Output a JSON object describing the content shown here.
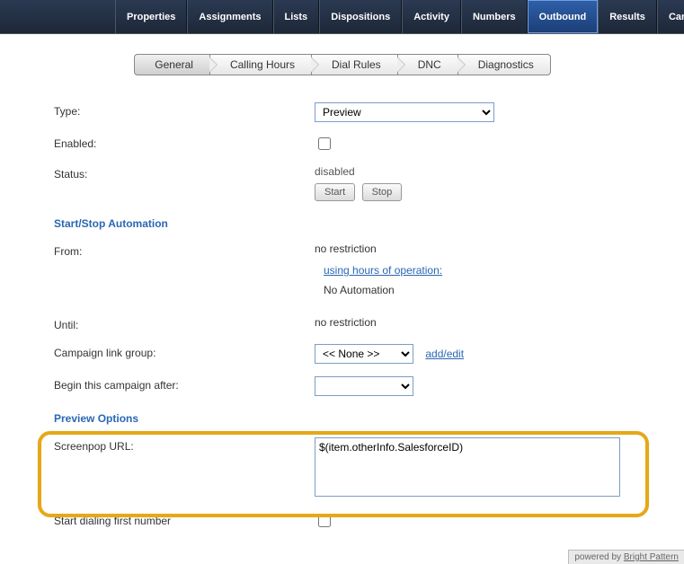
{
  "topnav": {
    "tabs": [
      {
        "label": "Properties"
      },
      {
        "label": "Assignments"
      },
      {
        "label": "Lists"
      },
      {
        "label": "Dispositions"
      },
      {
        "label": "Activity"
      },
      {
        "label": "Numbers"
      },
      {
        "label": "Outbound"
      },
      {
        "label": "Results"
      },
      {
        "label": "Canned"
      }
    ],
    "active_index": 6
  },
  "subnav": {
    "steps": [
      {
        "label": "General"
      },
      {
        "label": "Calling Hours"
      },
      {
        "label": "Dial Rules"
      },
      {
        "label": "DNC"
      },
      {
        "label": "Diagnostics"
      }
    ],
    "active_index": 0
  },
  "form": {
    "type_label": "Type:",
    "type_value": "Preview",
    "enabled_label": "Enabled:",
    "enabled_checked": false,
    "status_label": "Status:",
    "status_value": "disabled",
    "start_btn": "Start",
    "stop_btn": "Stop",
    "automation_header": "Start/Stop Automation",
    "from_label": "From:",
    "from_value": "no restriction",
    "hours_link": "using hours of operation:",
    "no_automation": "No Automation",
    "until_label": "Until:",
    "until_value": "no restriction",
    "linkgroup_label": "Campaign link group:",
    "linkgroup_value": "<< None >>",
    "addedit": "add/edit",
    "begin_label": "Begin this campaign after:",
    "begin_value": "",
    "preview_header": "Preview Options",
    "screenpop_label": "Screenpop URL:",
    "screenpop_value": "$(item.otherInfo.SalesforceID)",
    "startdial_label": "Start dialing first number",
    "startdial_checked": false
  },
  "footer": {
    "text": "powered by ",
    "brand": "Bright Pattern"
  }
}
